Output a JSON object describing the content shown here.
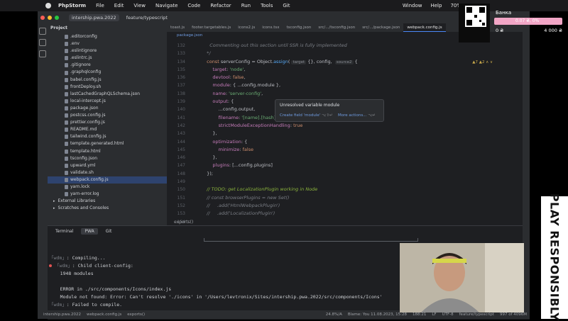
{
  "menubar": {
    "app": "PhpStorm",
    "items": [
      "File",
      "Edit",
      "View",
      "Navigate",
      "Code",
      "Refactor",
      "Run",
      "Tools",
      "Git"
    ],
    "right_items": [
      "Window",
      "Help"
    ],
    "battery": "70%",
    "icon": "apple-icon"
  },
  "titlebar": {
    "project": "intership.pwa.2022",
    "branch": "feature/typescript"
  },
  "project_panel": {
    "title": "Project",
    "files": [
      ".editorconfig",
      ".env",
      ".eslintignore",
      ".eslintrc.js",
      ".gitignore",
      ".graphqlconfig",
      "babel.config.js",
      "frontDeploy.sh",
      "lastCachedGraphQLSchema.json",
      "local-intercept.js",
      "package.json",
      "postcss.config.js",
      "prettier.config.js",
      "README.md",
      "tailwind.config.js",
      "template.generated.html",
      "template.html",
      "tsconfig.json",
      "upward.yml",
      "validate.sh",
      "webpack.config.js",
      "yarn.lock",
      "yarn-error.log"
    ],
    "libs": [
      "External Libraries",
      "Scratches and Consoles"
    ]
  },
  "editor": {
    "tabs": [
      "toast.js",
      "footer.targetables.js",
      "icons2.js",
      "icons.tsx",
      "tsconfig.json",
      "src/.../tsconfig.json",
      "src/.../package.json",
      "webpack.config.js"
    ],
    "active_tab": "webpack.config.js",
    "breadcrumb": "package.json",
    "line_numbers": [
      "132",
      "133",
      "134",
      "135",
      "136",
      "137",
      "138",
      "139",
      "140",
      "141",
      "142",
      "143",
      "144",
      "145",
      "146",
      "147",
      "148",
      "149",
      "150",
      "151",
      "152",
      "153",
      "154"
    ],
    "inspection": "▲7 ▲2 ∧ ∨",
    "status": "exports()",
    "popup": {
      "title": "Unresolved variable module",
      "action1": "Create field 'module'",
      "key1": "⌥⇧↵",
      "action2": "More actions...",
      "key2": "⌥↵"
    }
  },
  "terminal": {
    "tabs": [
      "Terminal",
      "PWA",
      "Git"
    ],
    "active_tab": "PWA",
    "lines": [
      {
        "ts": "「wdm」",
        "text": ": Compiling...",
        "err": false
      },
      {
        "ts": "「wdm」",
        "text": ": Child client-config:",
        "err": true
      },
      {
        "ts": "",
        "text": "    1948 modules",
        "err": false
      },
      {
        "ts": "",
        "text": "",
        "err": false
      },
      {
        "ts": "",
        "text": "    ERROR in ./src/components/Icons/index.js",
        "err": false
      },
      {
        "ts": "",
        "text": "    Module not found: Error: Can't resolve './icons' in '/Users/levtronix/Sites/intership.pwa.2022/src/components/Icons'",
        "err": false
      },
      {
        "ts": "「wdm」",
        "text": ": Failed to compile.",
        "err": false
      }
    ]
  },
  "statusbar": {
    "items": [
      "intership.pwa.2022",
      "webpack.config.js",
      "exports()"
    ],
    "right": [
      "24.8%/A",
      "Blame: You 11.08.2023, 15:28",
      "188:21",
      "LF",
      "UTF-8",
      "feature/typescript",
      "997 of 4096M"
    ]
  },
  "overlay": {
    "bank_title": "Банка",
    "bank_progress": "0.07 ₴, 0%",
    "bank_progress_fraction": 0.0,
    "bank_min": "0 ₴",
    "bank_max": "4 000 ₴",
    "bank_color": "#f2a6c6",
    "play_text": "PLAY RESPONSIBLY"
  }
}
